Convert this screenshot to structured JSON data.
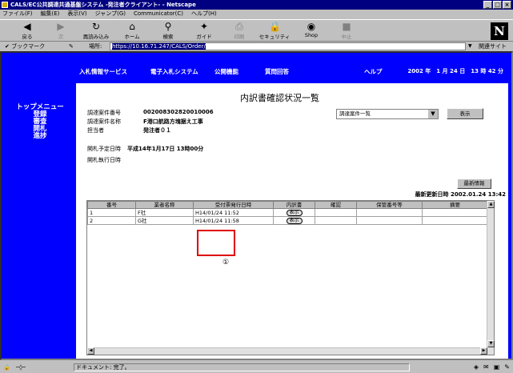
{
  "window": {
    "title": "CALS/EC公共調達共通基盤システム -発注者クライアント- - Netscape",
    "buttons": [
      "_",
      "□",
      "×"
    ]
  },
  "menu": [
    "ファイル(F)",
    "編集(E)",
    "表示(V)",
    "ジャンプ(G)",
    "Communicator(C)",
    "ヘルプ(H)"
  ],
  "toolbar": {
    "back": "戻る",
    "forward": "次",
    "reload": "再読み込み",
    "home": "ホーム",
    "search": "検索",
    "guide": "ガイド",
    "print": "印刷",
    "security": "セキュリティ",
    "shop": "Shop",
    "stop": "中止"
  },
  "logo": "N",
  "location": {
    "bookmark": "ブックマーク",
    "label": "場所:",
    "url": "https://10.16.71.247/CALS/Order/",
    "related": "関連サイト"
  },
  "topnav": {
    "items": [
      "入札情報サービス",
      "電子入札システム",
      "公開機能",
      "質問回答",
      "ヘルプ"
    ],
    "date": "2002 年　1 月 24 日　13 時 42 分"
  },
  "sidemenu": [
    "トップメニュー",
    "登録",
    "審査",
    "開札",
    "進捗"
  ],
  "page": {
    "title": "内訳書確認状況一覧",
    "fields": [
      {
        "label": "調達案件番号",
        "value": "002008302820010006"
      },
      {
        "label": "調達案件名称",
        "value": "F港口航路方塊据え工事"
      },
      {
        "label": "担当者",
        "value": "発注者０１"
      },
      {
        "label": "開札予定日時",
        "value": "平成14年1月17日 13時00分"
      },
      {
        "label": "開札執行日時",
        "value": ""
      }
    ],
    "select": "調達案件一覧",
    "display_button": "表示",
    "latest_button": "最新情報",
    "updated": "最新更新日時 2002.01.24 13:42",
    "columns": [
      "番号",
      "業者名称",
      "受付票発行日時",
      "内訳書",
      "確認",
      "保管番号等",
      "摘要"
    ],
    "rows": [
      {
        "no": "1",
        "name": "F社",
        "datetime": "H14/01/24 11:52",
        "detail": "表示"
      },
      {
        "no": "2",
        "name": "G社",
        "datetime": "H14/01/24 11:58",
        "detail": "表示"
      }
    ],
    "marker": "①"
  },
  "status": {
    "text": "ドキュメント: 完了。"
  }
}
